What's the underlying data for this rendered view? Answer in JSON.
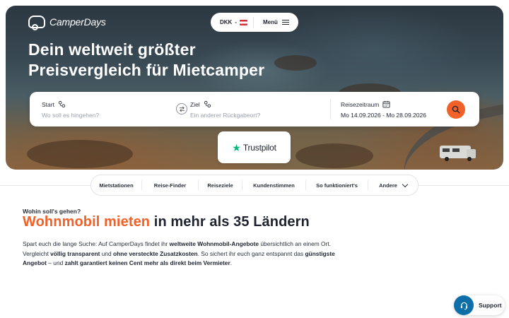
{
  "header": {
    "logo_text": "CamperDays",
    "currency_label": "DKK",
    "currency_separator": "-",
    "menu_label": "Menü"
  },
  "hero": {
    "title": "Dein weltweit größter Preisvergleich für Mietcamper"
  },
  "search": {
    "start_label": "Start",
    "start_placeholder": "Wo soll es hingehen?",
    "ziel_label": "Ziel",
    "ziel_placeholder": "Ein anderer Rückgabeort?",
    "date_label": "Reisezeitraum",
    "date_value": "Mo 14.09.2026 - Mo 28.09.2026"
  },
  "trustpilot": {
    "label": "Trustpilot"
  },
  "tabs": [
    {
      "label": "Mietstationen"
    },
    {
      "label": "Reise-Finder"
    },
    {
      "label": "Reiseziele"
    },
    {
      "label": "Kundenstimmen"
    },
    {
      "label": "So funktioniert's"
    },
    {
      "label": "Andere"
    }
  ],
  "content": {
    "kicker": "Wohin soll's gehen?",
    "headline_accent": "Wohnmobil mieten",
    "headline_rest": " in mehr als 35 Ländern",
    "p1": "Spart euch die lange Suche: Auf CamperDays findet ihr ",
    "p1_b": "weltweite Wohnmobil-Angebote",
    "p2": " übersichtlich an einem Ort. Vergleicht ",
    "p2_b": "völlig transparent",
    "p3": " und ",
    "p3_b": "ohne versteckte Zusatzkosten",
    "p4": ". So sichert ihr euch ganz entspannt das ",
    "p4_b": "günstigste Angebot",
    "p5": " – und ",
    "p5_b": "zahlt garantiert keinen Cent mehr als direkt beim Vermieter",
    "p6": "."
  },
  "support": {
    "label": "Support"
  },
  "colors": {
    "accent": "#f2612a",
    "support": "#0e6ea8",
    "trustpilot": "#00b67a"
  }
}
